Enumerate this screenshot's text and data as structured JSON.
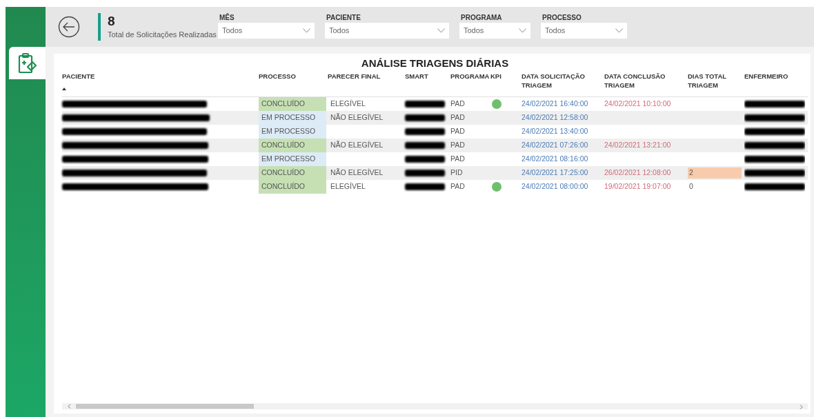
{
  "header": {
    "kpi": {
      "value": "8",
      "label": "Total de Solicitações Realizadas"
    },
    "filters": [
      {
        "label": "MÊS",
        "value": "Todos"
      },
      {
        "label": "PACIENTE",
        "value": "Todos"
      },
      {
        "label": "PROGRAMA",
        "value": "Todos"
      },
      {
        "label": "PROCESSO",
        "value": "Todos"
      }
    ]
  },
  "table": {
    "title": "ANÁLISE TRIAGENS DIÁRIAS",
    "columns": [
      "PACIENTE",
      "PROCESSO",
      "PARECER FINAL",
      "SMART",
      "PROGRAMA",
      "KPI",
      "DATA SOLICITAÇÃO TRIAGEM",
      "DATA CONCLUSÃO TRIAGEM",
      "DIAS TOTAL TRIAGEM",
      "ENFERMEIRO"
    ],
    "rows": [
      {
        "processo": {
          "text": "CONCLUÍDO",
          "color": "#c6e0b4"
        },
        "parecer": "ELEGÍVEL",
        "programa": "PAD",
        "kpi": {
          "color": "#70bf70"
        },
        "data_solicitacao": "24/02/2021 16:40:00",
        "data_conclusao": "24/02/2021 10:10:00"
      },
      {
        "processo": {
          "text": "EM PROCESSO",
          "color": "#ddebf7"
        },
        "parecer": "NÃO ELEGÍVEL",
        "programa": "PAD",
        "data_solicitacao": "24/02/2021 12:58:00"
      },
      {
        "processo": {
          "text": "EM PROCESSO",
          "color": "#ddebf7"
        },
        "programa": "PAD",
        "data_solicitacao": "24/02/2021 13:40:00"
      },
      {
        "processo": {
          "text": "CONCLUÍDO",
          "color": "#c6e0b4"
        },
        "parecer": "NÃO ELEGÍVEL",
        "programa": "PAD",
        "data_solicitacao": "24/02/2021 07:26:00",
        "data_conclusao": "24/02/2021 13:21:00"
      },
      {
        "processo": {
          "text": "EM PROCESSO",
          "color": "#ddebf7"
        },
        "programa": "PAD",
        "data_solicitacao": "24/02/2021 08:16:00"
      },
      {
        "processo": {
          "text": "CONCLUÍDO",
          "color": "#c6e0b4"
        },
        "parecer": "NÃO ELEGÍVEL",
        "programa": "PID",
        "data_solicitacao": "24/02/2021 17:25:00",
        "data_conclusao": "26/02/2021 12:08:00",
        "dias": {
          "text": "2",
          "color": "#f8cbad"
        }
      },
      {
        "processo": {
          "text": "CONCLUÍDO",
          "color": "#c6e0b4"
        },
        "parecer": "ELEGÍVEL",
        "programa": "PAD",
        "kpi": {
          "color": "#70bf70"
        },
        "data_solicitacao": "24/02/2021 08:00:00",
        "data_conclusao": "19/02/2021 19:07:00",
        "dias": {
          "text": "0"
        }
      }
    ]
  }
}
